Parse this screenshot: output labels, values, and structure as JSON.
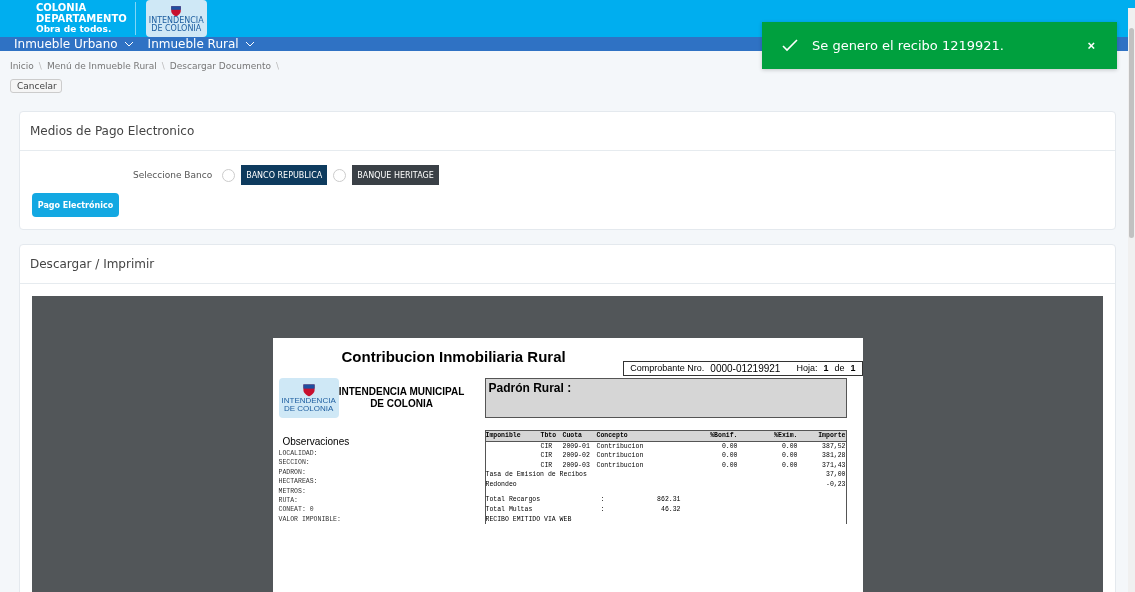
{
  "header": {
    "brand_lines": [
      "COLONIA",
      "DEPARTAMENTO",
      "Obra de todos."
    ],
    "logo_caption": [
      "INTENDENCIA",
      "DE COLONIA"
    ]
  },
  "nav": {
    "items": [
      {
        "label": "Inmueble Urbano"
      },
      {
        "label": "Inmueble Rural"
      }
    ]
  },
  "toast": {
    "message": "Se genero el recibo 1219921.",
    "close": "×"
  },
  "breadcrumb": [
    "Inicio",
    "Menú de Inmueble Rural",
    "Descargar Documento"
  ],
  "breadcrumb_separator": "\\",
  "cancel_button": "Cancelar",
  "payment_card": {
    "title": "Medios de Pago Electronico",
    "bank_label": "Seleccione Banco",
    "banks": [
      {
        "name": "BANCO REPUBLICA",
        "selected": false
      },
      {
        "name": "BANQUE HERITAGE",
        "selected": false
      }
    ],
    "pay_button": "Pago Electrónico"
  },
  "download_card": {
    "title": "Descargar / Imprimir"
  },
  "document": {
    "title": "Contribucion Inmobiliaria Rural",
    "receipt_label": "Comprobante Nro.",
    "receipt_number": "0000-01219921",
    "sheet_label": "Hoja:",
    "sheet_current": "1",
    "sheet_of": "de",
    "sheet_total": "1",
    "issuer": [
      "INTENDENCIA MUNICIPAL",
      "DE COLONIA"
    ],
    "logo_caption": [
      "INTENDENCIA",
      "DE COLONIA"
    ],
    "padron_label": "Padrón Rural :",
    "observations_title": "Observaciones",
    "observations": [
      "LOCALIDAD:",
      "SECCION:",
      "PADRON:",
      "HECTAREAS:",
      "METROS:",
      "RUTA:",
      "CONEAT: 0",
      "VALOR IMPONIBLE:"
    ],
    "columns": [
      "Imponible",
      "Tbto",
      "Cuota",
      "Concepto",
      "%Bonif.",
      "%Exim.",
      "Importe"
    ],
    "rows": [
      [
        "",
        "CIR",
        "2009-01",
        "Contribucion",
        "0.00",
        "0.00",
        "387,52"
      ],
      [
        "",
        "CIR",
        "2009-02",
        "Contribucion",
        "0.00",
        "0.00",
        "381,28"
      ],
      [
        "",
        "CIR",
        "2009-03",
        "Contribucion",
        "0.00",
        "0.00",
        "371,43"
      ]
    ],
    "extra_lines": [
      {
        "label": "Tasa de Emision de Recibos",
        "amount": "37,00"
      },
      {
        "label": "Redondeo",
        "amount": "-0,23"
      }
    ],
    "totals": [
      {
        "label": "Total Recargos",
        "sep": ":",
        "amount": "862.31"
      },
      {
        "label": "Total Multas",
        "sep": ":",
        "amount": "46.32"
      }
    ],
    "footer_note": "RECIBO EMITIDO VIA WEB"
  }
}
